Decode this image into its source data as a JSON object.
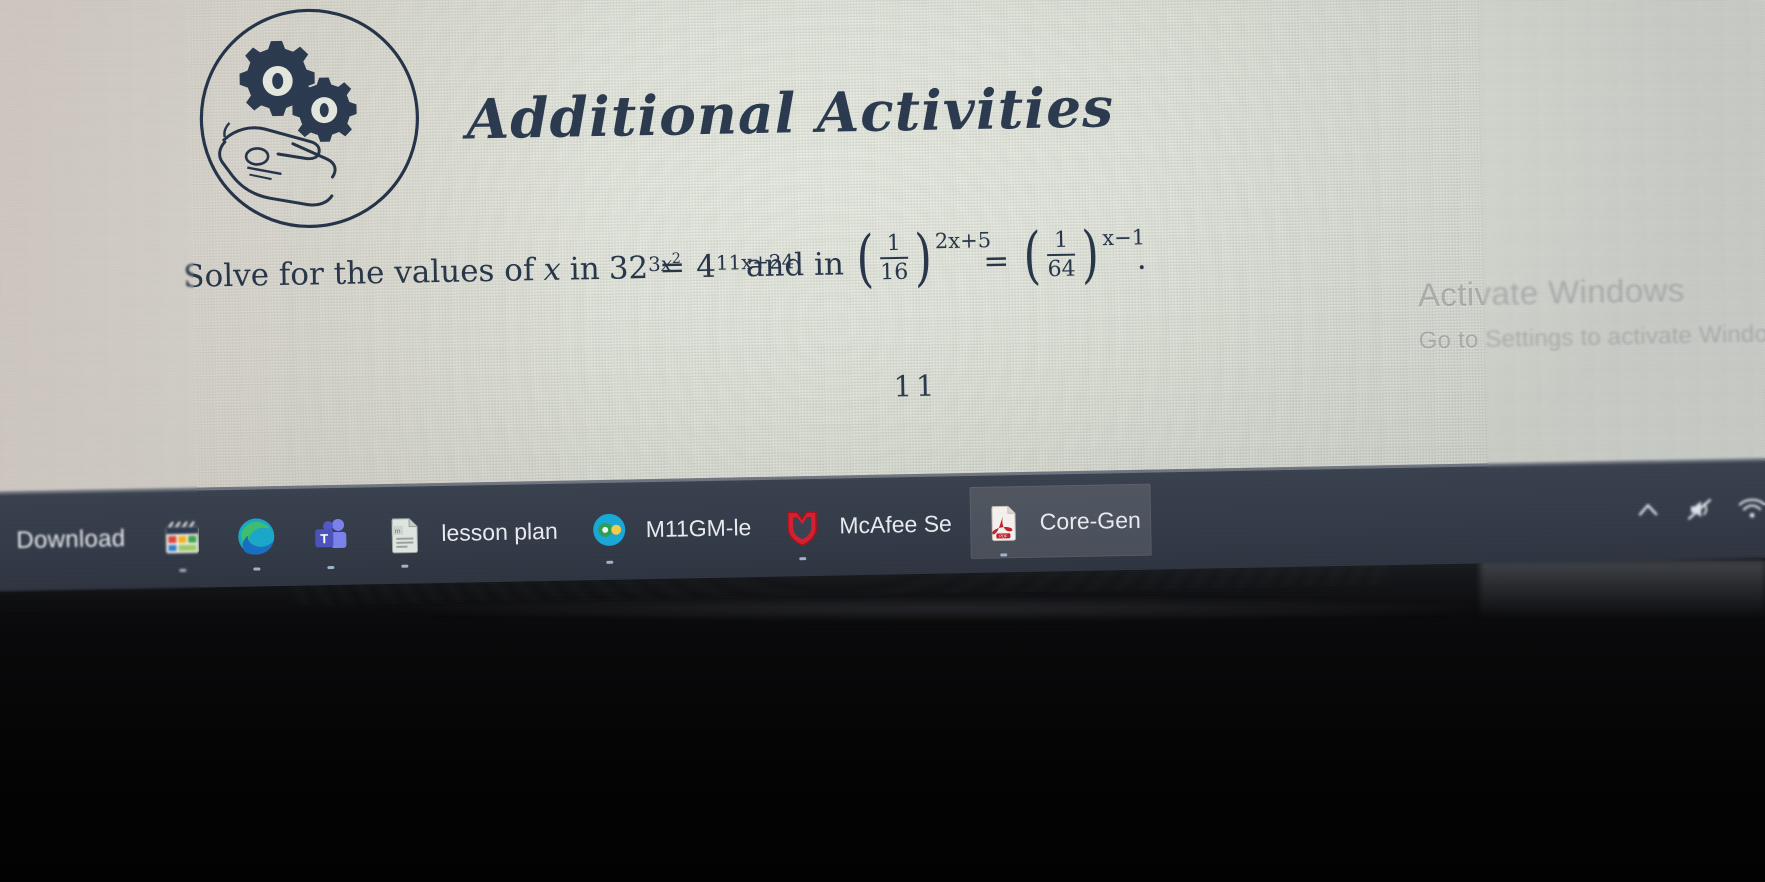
{
  "document": {
    "header": {
      "icon": "gears-in-hand-circle-icon",
      "title": "Additional Activities"
    },
    "problem": {
      "lead": "Solve for the values of",
      "variable": "x",
      "connector_in": "in",
      "equation1": {
        "left_base": "32",
        "left_exponent_coeff": "3",
        "left_exponent_var": "x",
        "left_exponent_power": "2",
        "equals": "=",
        "right_base": "4",
        "right_exponent": "11x+24"
      },
      "connector_and": "and in",
      "equation2": {
        "left_numerator": "1",
        "left_denominator": "16",
        "left_exponent": "2x+5",
        "equals": "=",
        "right_numerator": "1",
        "right_denominator": "64",
        "right_exponent": "x−1"
      },
      "terminator": "."
    },
    "page_number": "11"
  },
  "watermark": {
    "title": "Activate Windows",
    "subtitle": "Go to Settings to activate Windows."
  },
  "taskbar": {
    "left_label": "Download",
    "items": [
      {
        "label": "",
        "icon": "photos-app-icon",
        "active": false,
        "running": true
      },
      {
        "label": "",
        "icon": "microsoft-edge-icon",
        "active": false,
        "running": true
      },
      {
        "label": "",
        "icon": "microsoft-teams-icon",
        "active": false,
        "running": true
      },
      {
        "label": "lesson plan",
        "icon": "word-document-icon",
        "active": false,
        "running": true
      },
      {
        "label": "M11GM-le",
        "icon": "office-app-icon",
        "active": false,
        "running": true
      },
      {
        "label": "McAfee Se",
        "icon": "mcafee-shield-icon",
        "active": false,
        "running": true
      },
      {
        "label": "Core-Gen",
        "icon": "pdf-document-icon",
        "active": true,
        "running": true
      }
    ],
    "tray": [
      {
        "icon": "chevron-up-icon",
        "name": "show-hidden-icons"
      },
      {
        "icon": "speaker-muted-icon",
        "name": "volume-muted"
      },
      {
        "icon": "network-icon",
        "name": "network-status"
      }
    ]
  },
  "colors": {
    "ink": "#28364a",
    "paper": "#e4e7dd",
    "taskbar": "#343b48",
    "taskbar_text": "#e8ebf0",
    "mcafee_red": "#c8202e",
    "edge_blue": "#1fb0d6",
    "teams_purple": "#5b5fc7",
    "watermark_grey": "#5f6468"
  }
}
